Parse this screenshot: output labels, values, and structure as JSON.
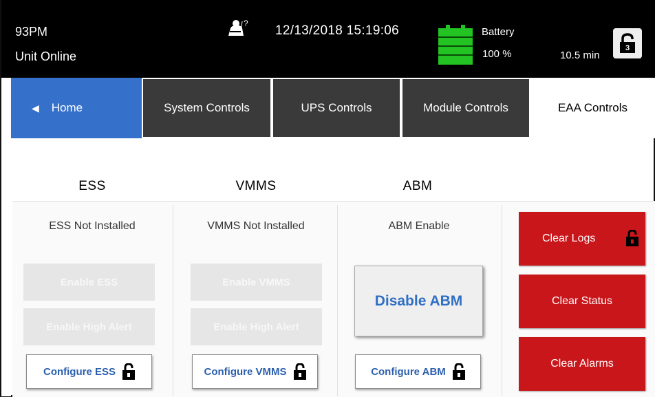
{
  "status_bar": {
    "unit_name": "93PM",
    "unit_status": "Unit Online",
    "help_icon": "operator-help-icon",
    "datetime": "12/13/2018 15:19:06",
    "battery_label": "Battery",
    "battery_percent": "100 %",
    "runtime": "10.5 min",
    "lock_level": "3",
    "battery_color": "#22c322"
  },
  "tabs": {
    "home": "Home",
    "system_controls": "System Controls",
    "ups_controls": "UPS Controls",
    "module_controls": "Module Controls",
    "eaa_controls": "EAA Controls"
  },
  "sections": {
    "ess": {
      "title": "ESS",
      "status": "ESS Not Installed",
      "enable_button": "Enable ESS",
      "high_alert_button": "Enable High Alert",
      "configure_button": "Configure ESS"
    },
    "vmms": {
      "title": "VMMS",
      "status": "VMMS Not Installed",
      "enable_button": "Enable VMMS",
      "high_alert_button": "Enable High Alert",
      "configure_button": "Configure VMMS"
    },
    "abm": {
      "title": "ABM",
      "status": "ABM Enable",
      "disable_button": "Disable ABM",
      "configure_button": "Configure ABM"
    }
  },
  "actions": {
    "clear_logs": "Clear Logs",
    "clear_status": "Clear Status",
    "clear_alarms": "Clear Alarms"
  },
  "colors": {
    "home_tab": "#3571cb",
    "tab_dark": "#3a3a3a",
    "action_red": "#c8161a",
    "link_blue": "#2b5fae"
  }
}
